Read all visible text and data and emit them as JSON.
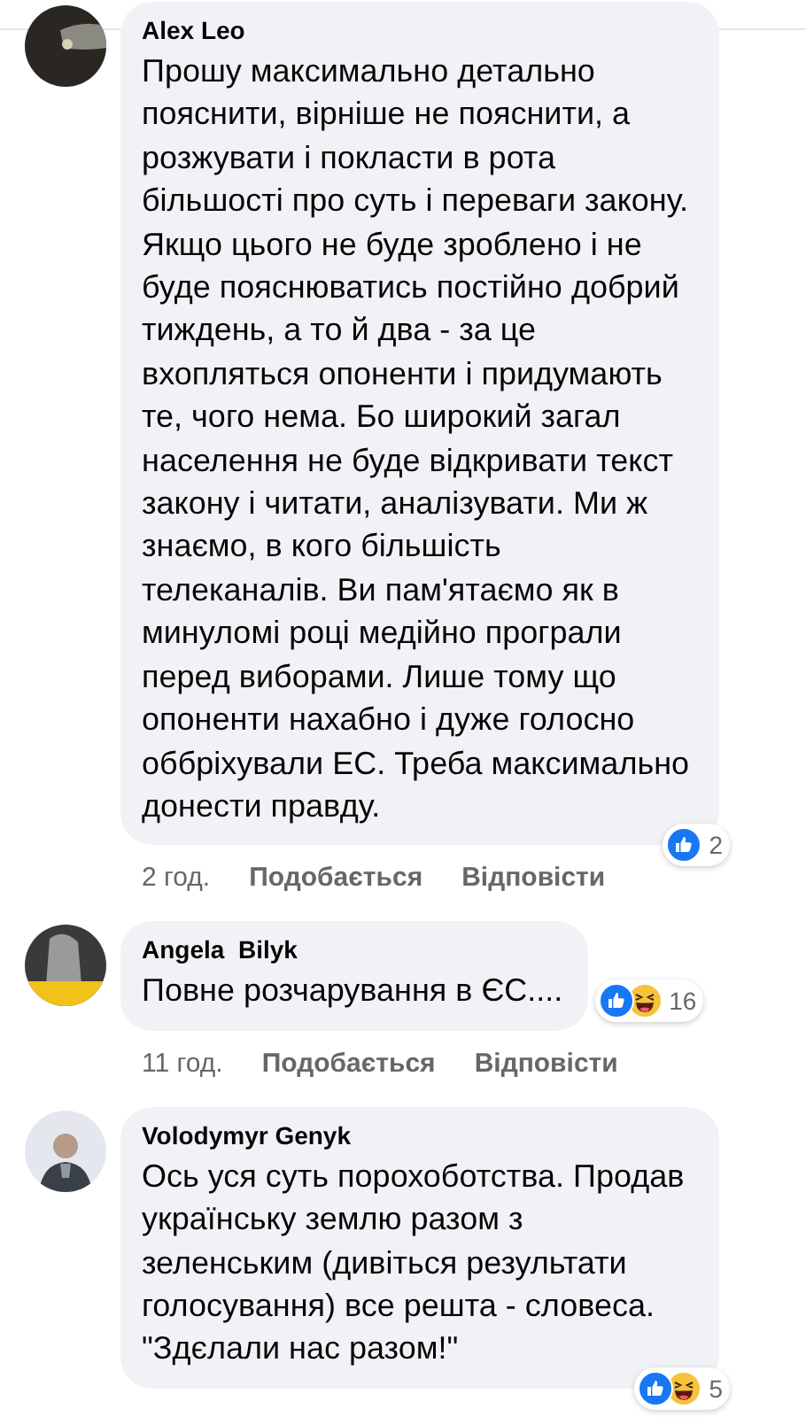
{
  "comments": [
    {
      "author": "Alex Leo",
      "avatar": {
        "kind": "picture"
      },
      "text": "Прошу максимально детально пояснити, вірніше не пояснити, а розжувати і покласти в рота більшості про суть і переваги закону. Якщо цього не буде зроблено і не буде пояснюватись постійно добрий тиждень, а то й два - за це вхопляться опоненти і придумають те, чого нема. Бо широкий загал населення не буде відкривати текст закону і читати, аналізувати. Ми ж знаємо, в кого більшість телеканалів. Ви пам'ятаємо як в минуломі році медійно програли перед виборами. Лише тому що опоненти нахабно і дуже голосно оббріхували ЕС. Треба максимально донести правду.",
      "reactions": [
        {
          "kind": "like"
        }
      ],
      "reaction_count": "2",
      "time": "2 год.",
      "actions": [
        "Подобається",
        "Відповісти"
      ]
    },
    {
      "author": "Angela  Bilyk",
      "avatar": {
        "kind": "picture"
      },
      "text": "Повне розчарування в ЄС....",
      "reactions": [
        {
          "kind": "like"
        },
        {
          "kind": "haha"
        }
      ],
      "reaction_count": "16",
      "time": "11 год.",
      "actions": [
        "Подобається",
        "Відповісти"
      ]
    },
    {
      "author": "Volodymyr Genyk",
      "avatar": {
        "kind": "picture"
      },
      "text": "Ось уся суть порохоботства. Продав українську землю разом з зеленським (дивіться результати голосування) все решта - словеса. \"Здєлали нас разом!\"",
      "reactions": [
        {
          "kind": "like"
        },
        {
          "kind": "haha"
        }
      ],
      "reaction_count": "5"
    }
  ]
}
